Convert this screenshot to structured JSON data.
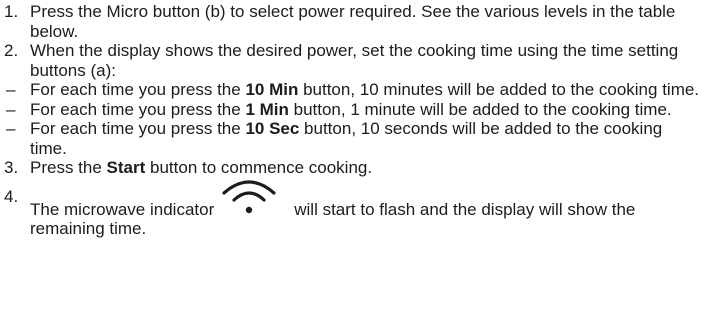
{
  "steps": [
    {
      "id": "step1",
      "marker": "1.",
      "parts": [
        {
          "t": "Press the Micro button (b) to select power required. See the various levels in the table below."
        }
      ]
    },
    {
      "id": "step2",
      "marker": "2.",
      "parts": [
        {
          "t": "When the display shows the desired power, set the cooking time using the time setting buttons (a):"
        }
      ]
    }
  ],
  "bullets": [
    {
      "marker": "–",
      "pre": "For each time you press the ",
      "bold": "10 Min",
      "post": " button, 10 minutes will be added to the cooking time."
    },
    {
      "marker": "–",
      "pre": "For each time you press the ",
      "bold": "1 Min",
      "post": " button, 1 minute will be added to the cooking time."
    },
    {
      "marker": "–",
      "pre": "For each time you press the ",
      "bold": "10 Sec",
      "post": " button, 10 seconds will be added to the cooking time."
    }
  ],
  "step3": {
    "marker": "3.",
    "pre": "Press the ",
    "bold": "Start",
    "post": " button to commence cooking."
  },
  "step4": {
    "marker": "4.",
    "pre": "The microwave indicator",
    "post": "will start to flash and the display will show the remaining time.",
    "icon": "microwave-indicator-icon"
  }
}
